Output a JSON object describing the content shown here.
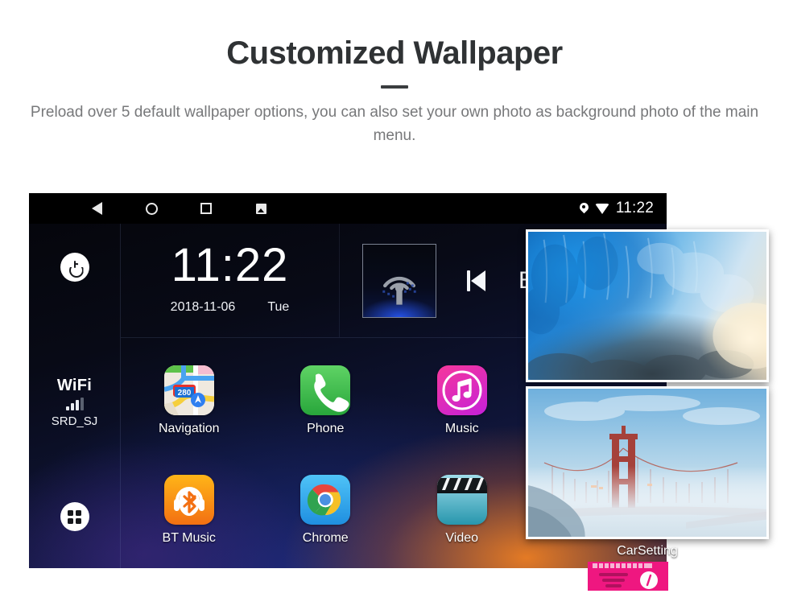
{
  "promo": {
    "title": "Customized Wallpaper",
    "subtitle": "Preload over 5 default wallpaper options, you can also set your own photo as background photo of the main menu."
  },
  "device": {
    "status_bar": {
      "nav": [
        {
          "name": "back-icon",
          "label": "Back"
        },
        {
          "name": "home-icon",
          "label": "Home"
        },
        {
          "name": "recents-icon",
          "label": "Recents"
        },
        {
          "name": "screenshot-icon",
          "label": "Screenshot"
        }
      ],
      "location_icon": "location-pin-icon",
      "wifi_icon": "wifi-icon",
      "time": "11:22"
    },
    "left_rail": {
      "power_icon": "power-icon",
      "wifi_label": "WiFi",
      "wifi_ssid": "SRD_SJ",
      "wifi_signal_bars": 3,
      "apps_icon": "apps-grid-icon"
    },
    "clock_widget": {
      "time": "11:22",
      "date": "2018-11-06",
      "weekday": "Tue"
    },
    "media_widget": {
      "album_art_icon": "radio-antenna-icon",
      "prev_icon": "previous-track-icon",
      "track_label": "B"
    },
    "apps": [
      {
        "name": "Navigation",
        "icon": "maps-icon",
        "shield": "280"
      },
      {
        "name": "Phone",
        "icon": "phone-icon"
      },
      {
        "name": "Music",
        "icon": "music-note-icon"
      },
      {
        "name": "BT Music",
        "icon": "bluetooth-headphones-icon"
      },
      {
        "name": "Chrome",
        "icon": "chrome-icon"
      },
      {
        "name": "Video",
        "icon": "clapperboard-icon"
      },
      {
        "name": "CarSetting",
        "icon": "car-setting-icon"
      }
    ],
    "wallpaper_cards": [
      {
        "name": "ice-cave-wallpaper"
      },
      {
        "name": "radio-widget-wallpaper"
      },
      {
        "name": "golden-gate-wallpaper"
      }
    ]
  },
  "colors": {
    "title": "#2f3234",
    "subtitle": "#77787a",
    "phone_green": "#28a63b",
    "music_pink": "#f6389b",
    "bt_orange": "#f37012",
    "chrome_blue": "#1f8fe0",
    "video_teal": "#2796ad",
    "radio_pink": "#f0167f"
  }
}
